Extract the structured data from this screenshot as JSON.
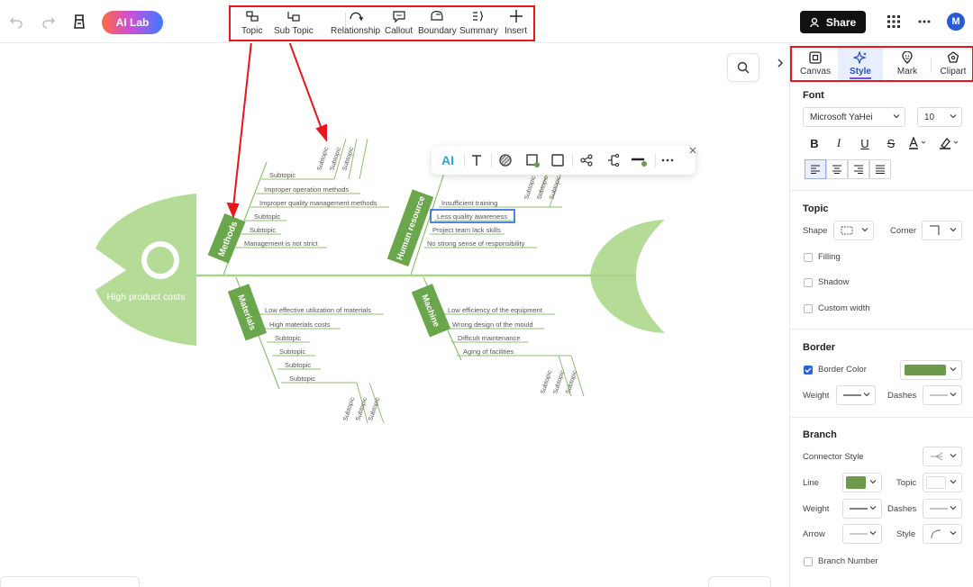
{
  "header": {
    "ai_lab": "AI Lab",
    "share": "Share",
    "avatar_initial": "M",
    "ribbon": [
      "Topic",
      "Sub Topic",
      "Relationship",
      "Callout",
      "Boundary",
      "Summary",
      "Insert"
    ]
  },
  "diagram": {
    "head_label": "High product costs",
    "categories": {
      "methods": "Methods",
      "human": "Human resource",
      "materials": "Materials",
      "machine": "Machine"
    },
    "methods_items": [
      "Subtopic",
      "Improper operation methods",
      "Improper quality management methods",
      "Subtopic",
      "Subtopic",
      "Management is not strict"
    ],
    "human_items": [
      "Insufficient training",
      "Less quality awareness",
      "Project team lack skills",
      "No strong sense of responsibility"
    ],
    "materials_items": [
      "Low effective utilization of materials",
      "High materials costs",
      "Subtopic",
      "Subtopic",
      "Subtopic",
      "Subtopic"
    ],
    "machine_items": [
      "Low efficiency of the equipment",
      "Wrong design of the mould",
      "Difficult maintenance",
      "Aging of facilities"
    ],
    "subtopic": "Subtopic"
  },
  "floatbar": {
    "ai": "AI"
  },
  "panel": {
    "tabs": [
      "Canvas",
      "Style",
      "Mark",
      "Clipart"
    ],
    "active_tab": "Style",
    "font": {
      "title": "Font",
      "family": "Microsoft YaHei",
      "size": "10"
    },
    "topic": {
      "title": "Topic",
      "shape": "Shape",
      "corner": "Corner",
      "filling": "Filling",
      "shadow": "Shadow",
      "custom_width": "Custom width"
    },
    "border": {
      "title": "Border",
      "color_label": "Border Color",
      "color": "#6a9a4a",
      "weight": "Weight",
      "dashes": "Dashes"
    },
    "branch": {
      "title": "Branch",
      "connector": "Connector Style",
      "line": "Line",
      "line_color": "#6a9a4a",
      "topic": "Topic",
      "weight": "Weight",
      "dashes": "Dashes",
      "arrow": "Arrow",
      "style": "Style",
      "branch_number": "Branch Number"
    }
  },
  "colors": {
    "fish": "#b5dc96",
    "spine": "#a8d58a",
    "cat": "#6aa64c",
    "red": "#e8161b",
    "accent": "#2a64d9"
  }
}
